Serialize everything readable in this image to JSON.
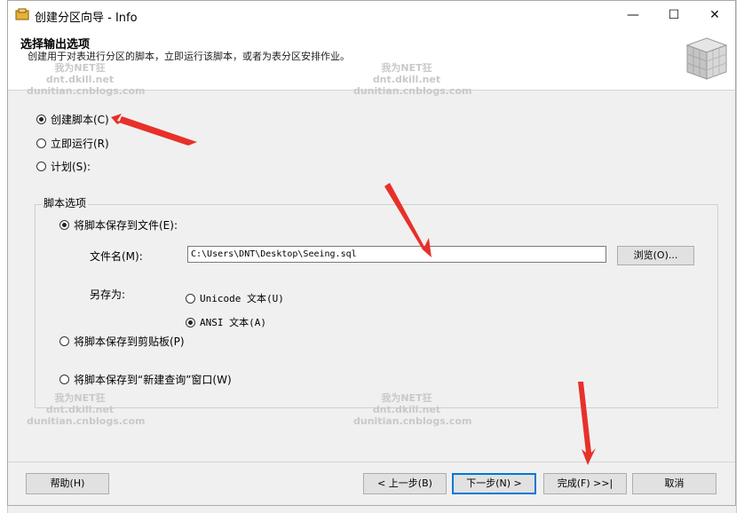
{
  "window": {
    "title": "创建分区向导 - Info",
    "controls": {
      "minimize": "—",
      "maximize": "☐",
      "close": "✕"
    }
  },
  "header": {
    "title": "选择输出选项",
    "subtitle": "创建用于对表进行分区的脚本，立即运行该脚本，或者为表分区安排作业。"
  },
  "options": {
    "create_script": "创建脚本(C)",
    "run_now": "立即运行(R)",
    "schedule": "计划(S):",
    "selected": "create_script"
  },
  "script_options": {
    "group_label": "脚本选项",
    "save_to_file": "将脚本保存到文件(E):",
    "file_name_label": "文件名(M):",
    "file_name_value": "C:\\Users\\DNT\\Desktop\\Seeing.sql",
    "browse_button": "浏览(O)...",
    "save_as_label": "另存为:",
    "unicode_text": "Unicode 文本(U)",
    "ansi_text": "ANSI 文本(A)",
    "save_to_clipboard": "将脚本保存到剪贴板(P)",
    "save_to_query": "将脚本保存到“新建查询”窗口(W)"
  },
  "footer": {
    "help": "帮助(H)",
    "back": "< 上一步(B)",
    "next": "下一步(N) >",
    "finish": "完成(F) >>|",
    "cancel": "取消"
  },
  "watermark": {
    "line1": "我为NET狂",
    "line2": "dnt.dkill.net",
    "line3": "dunitian.cnblogs.com"
  },
  "colors": {
    "arrow": "#e8302a",
    "accent": "#0078d7"
  }
}
